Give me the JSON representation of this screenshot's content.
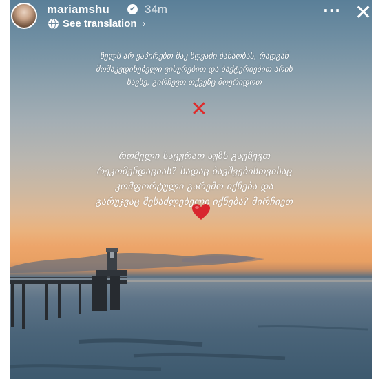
{
  "header": {
    "username": "mariamshu",
    "verified_glyph": "✔",
    "time_ago": "34m",
    "translate_label": "See translation",
    "chevron": "›",
    "more_glyph": "···",
    "close_glyph": "✕"
  },
  "caption_top": {
    "lines": [
      "წელს არ ვაპირებთ მაკ ზღვაში ბანაობას, რადგან",
      "მომაკვდინებელი ვისურებით და ბაქტერიებით არის",
      "სავსე, გირჩევთ თქვენც მოერიდოთ"
    ]
  },
  "cross_glyph": "✕",
  "caption_bottom": {
    "lines": [
      "რომელი საცურაო აუზს გაუწევთ",
      "რეკომენდაციას? სადაც ბავშვებისთვისაც",
      "კომფორტული გარემო იქნება და",
      "გარუჯვაც შესაძლებელი იქნება? მირჩიეთ"
    ]
  },
  "colors": {
    "cross": "#e02a2a",
    "heart": "#d8262e",
    "sky_top": "#5a7f98",
    "sunset": "#eda56a",
    "sea": "#3d596e"
  },
  "icons": {
    "globe": "globe-icon",
    "verified": "verified-badge-icon",
    "heart": "red-heart-icon",
    "cross": "red-cross-icon"
  }
}
